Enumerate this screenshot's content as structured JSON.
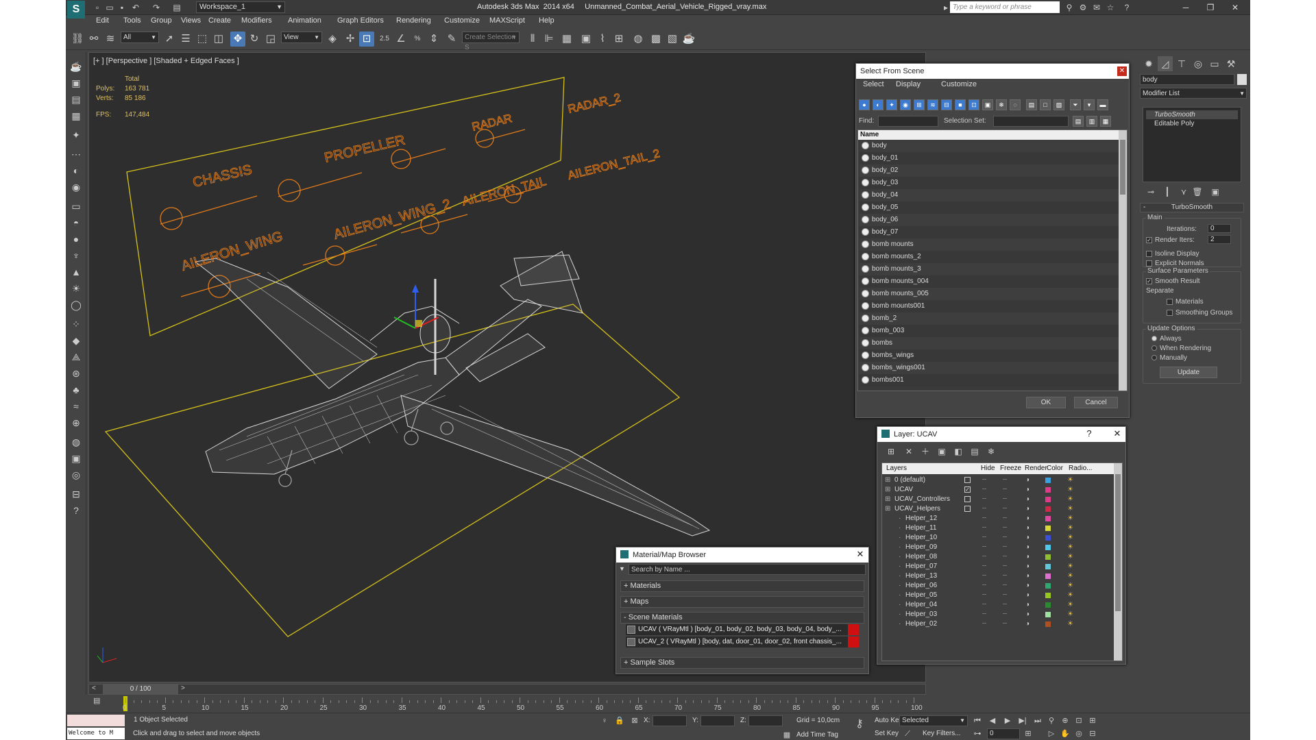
{
  "title_bar": {
    "workspace": "Workspace_1",
    "window_title": "Autodesk 3ds Max  2014 x64     Unmanned_Combat_Aerial_Vehicle_Rigged_vray.max",
    "search_placeholder": "Type a keyword or phrase"
  },
  "menu": [
    "Edit",
    "Tools",
    "Group",
    "Views",
    "Create",
    "Modifiers",
    "Animation",
    "Graph Editors",
    "Rendering",
    "Customize",
    "MAXScript",
    "Help"
  ],
  "toolbar": {
    "filter_select": "All",
    "ref_coord": "View",
    "snap_label": "2.5",
    "named_selection": "Create Selection S"
  },
  "viewport": {
    "label": "[+ ] [Perspective ] [Shaded + Edged Faces ]",
    "stats": {
      "header": "Total",
      "polys_label": "Polys:",
      "polys": "163 781",
      "verts_label": "Verts:",
      "verts": "85 186",
      "fps_label": "FPS:",
      "fps": "147,484"
    },
    "controls": [
      "CHASSIS",
      "PROPELLER",
      "RADAR",
      "RADAR_2",
      "AILERON_WING",
      "AILERON_WING_2",
      "AILERON_TAIL",
      "AILERON_TAIL_2"
    ]
  },
  "select_from_scene": {
    "title": "Select From Scene",
    "menus": [
      "Select",
      "Display",
      "Customize"
    ],
    "find_label": "Find:",
    "selection_set_label": "Selection Set:",
    "col_name": "Name",
    "items": [
      "body",
      "body_01",
      "body_02",
      "body_03",
      "body_04",
      "body_05",
      "body_06",
      "body_07",
      "bomb mounts",
      "bomb mounts_2",
      "bomb mounts_3",
      "bomb mounts_004",
      "bomb mounts_005",
      "bomb mounts001",
      "bomb_2",
      "bomb_003",
      "bombs",
      "bombs_wings",
      "bombs_wings001",
      "bombs001"
    ],
    "ok": "OK",
    "cancel": "Cancel"
  },
  "layer_dialog": {
    "title": "Layer: UCAV",
    "help": "?",
    "cols": {
      "layers": "Layers",
      "hide": "Hide",
      "freeze": "Freeze",
      "render": "Render",
      "color": "Color",
      "radio": "Radio..."
    },
    "rows": [
      {
        "name": "0 (default)",
        "indent": 0,
        "color": "#3aa0e0",
        "cur": ""
      },
      {
        "name": "UCAV",
        "indent": 0,
        "color": "#e03a8a",
        "cur": "✓"
      },
      {
        "name": "UCAV_Controllers",
        "indent": 0,
        "color": "#e03a8a",
        "cur": ""
      },
      {
        "name": "UCAV_Helpers",
        "indent": 0,
        "color": "#d02a4a",
        "cur": ""
      },
      {
        "name": "Helper_12",
        "indent": 1,
        "color": "#e04aa0",
        "cur": ""
      },
      {
        "name": "Helper_11",
        "indent": 1,
        "color": "#d8d838",
        "cur": ""
      },
      {
        "name": "Helper_10",
        "indent": 1,
        "color": "#3a50d8",
        "cur": ""
      },
      {
        "name": "Helper_09",
        "indent": 1,
        "color": "#50c8e8",
        "cur": ""
      },
      {
        "name": "Helper_08",
        "indent": 1,
        "color": "#90c030",
        "cur": ""
      },
      {
        "name": "Helper_07",
        "indent": 1,
        "color": "#60c8d8",
        "cur": ""
      },
      {
        "name": "Helper_13",
        "indent": 1,
        "color": "#e070d0",
        "cur": ""
      },
      {
        "name": "Helper_06",
        "indent": 1,
        "color": "#30a870",
        "cur": ""
      },
      {
        "name": "Helper_05",
        "indent": 1,
        "color": "#98c820",
        "cur": ""
      },
      {
        "name": "Helper_04",
        "indent": 1,
        "color": "#2a8a30",
        "cur": ""
      },
      {
        "name": "Helper_03",
        "indent": 1,
        "color": "#a0e0a0",
        "cur": ""
      },
      {
        "name": "Helper_02",
        "indent": 1,
        "color": "#b05020",
        "cur": ""
      }
    ]
  },
  "material_browser": {
    "title": "Material/Map Browser",
    "search_placeholder": "Search by Name ...",
    "groups": [
      "+ Materials",
      "+ Maps",
      "- Scene Materials",
      "+ Sample Slots"
    ],
    "materials": [
      "UCAV  ( VRayMtl ) [body_01, body_02, body_03, body_04, body_...",
      "UCAV_2  ( VRayMtl ) [body, dat, door_01, door_02, front chassis_..."
    ]
  },
  "command_panel": {
    "object_name": "body",
    "modifier_list": "Modifier List",
    "stack": [
      "TurboSmooth",
      "Editable Poly"
    ],
    "rollout": "TurboSmooth",
    "main_label": "Main",
    "iterations_label": "Iterations:",
    "iterations": "0",
    "render_iters_label": "Render Iters:",
    "render_iters": "2",
    "isoline": "Isoline Display",
    "explicit_normals": "Explicit Normals",
    "surface_params": "Surface Parameters",
    "smooth_result": "Smooth Result",
    "separate": "Separate",
    "materials": "Materials",
    "smoothing_groups": "Smoothing Groups",
    "update_options": "Update Options",
    "always": "Always",
    "when_rendering": "When Rendering",
    "manually": "Manually",
    "update_btn": "Update"
  },
  "timeline": {
    "slider": "0 / 100",
    "ticks": [
      "0",
      "5",
      "10",
      "15",
      "20",
      "25",
      "30",
      "35",
      "40",
      "45",
      "50",
      "55",
      "60",
      "65",
      "70",
      "75",
      "80",
      "85",
      "90",
      "95",
      "100"
    ]
  },
  "status": {
    "listener": "Welcome to M",
    "selected": "1 Object Selected",
    "prompt": "Click and drag to select and move objects",
    "x_label": "X:",
    "y_label": "Y:",
    "z_label": "Z:",
    "grid": "Grid = 10,0cm",
    "auto_key": "Auto Key",
    "set_key": "Set Key",
    "key_mode": "Selected",
    "key_filters": "Key Filters...",
    "add_time_tag": "Add Time Tag",
    "frame": "0"
  }
}
